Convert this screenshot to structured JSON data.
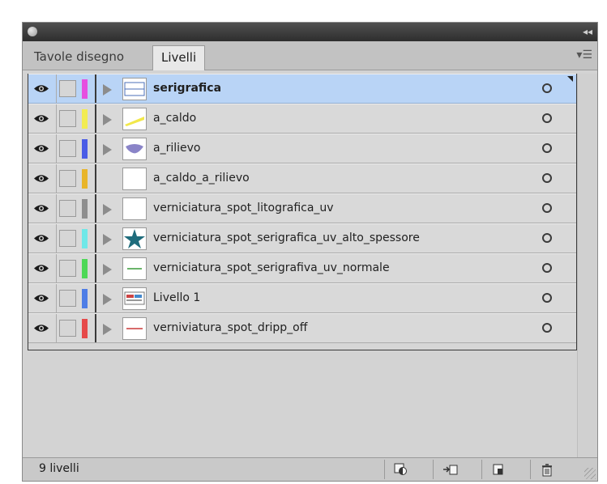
{
  "tabs": [
    {
      "label": "Tavole disegno",
      "active": false
    },
    {
      "label": "Livelli",
      "active": true
    }
  ],
  "layers": [
    {
      "name": "serigrafica",
      "color": "#e64fe0",
      "selected": true,
      "expandable": true,
      "thumb": "line-rectangle"
    },
    {
      "name": "a_caldo",
      "color": "#f2ec52",
      "selected": false,
      "expandable": true,
      "thumb": "yellow-stroke"
    },
    {
      "name": "a_rilievo",
      "color": "#4a5ce6",
      "selected": false,
      "expandable": true,
      "thumb": "purple-shape"
    },
    {
      "name": "a_caldo_a_rilievo",
      "color": "#e8b52a",
      "selected": false,
      "expandable": false,
      "thumb": "blank"
    },
    {
      "name": "verniciatura_spot_litografica_uv",
      "color": "#8e8e8e",
      "selected": false,
      "expandable": true,
      "thumb": "blank"
    },
    {
      "name": "verniciatura_spot_serigrafica_uv_alto_spessore",
      "color": "#6fe8e8",
      "selected": false,
      "expandable": true,
      "thumb": "teal-star"
    },
    {
      "name": "verniciatura_spot_serigrafiva_uv_normale",
      "color": "#4ed857",
      "selected": false,
      "expandable": true,
      "thumb": "green-text"
    },
    {
      "name": "Livello 1",
      "color": "#4e7de6",
      "selected": false,
      "expandable": true,
      "thumb": "artwork"
    },
    {
      "name": "verniviatura_spot_dripp_off",
      "color": "#e64a4a",
      "selected": false,
      "expandable": true,
      "thumb": "red-text"
    }
  ],
  "footer": {
    "count_label": "9 livelli",
    "buttons": [
      "make-clipping-mask-icon",
      "create-sublayer-icon",
      "new-layer-icon",
      "trash-icon"
    ]
  },
  "icons": {
    "visibility": "eye-icon",
    "lock": "lock-toggle",
    "target": "target-circle-icon",
    "expand": "disclosure-triangle-icon",
    "panel_menu": "panel-menu-icon",
    "close": "close-icon",
    "collapse": "collapse-icon"
  }
}
